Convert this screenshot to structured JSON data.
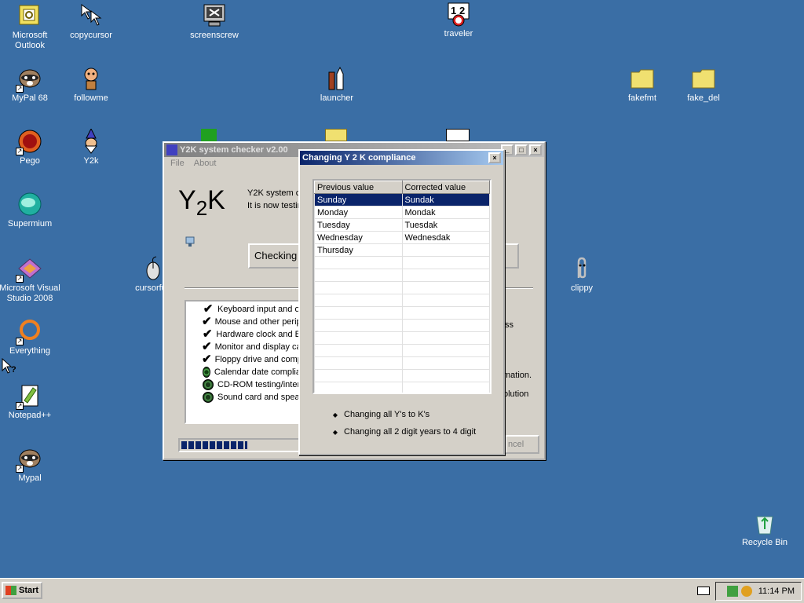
{
  "desktop": {
    "icons": [
      {
        "label": "Microsoft\nOutlook",
        "icon": "outlook-icon"
      },
      {
        "label": "copycursor",
        "icon": "cursors-icon"
      },
      {
        "label": "screenscrew",
        "icon": "monitor-icon"
      },
      {
        "label": "traveler",
        "icon": "calendar-clock-icon"
      },
      {
        "label": "MyPal 68",
        "icon": "raccoon-icon"
      },
      {
        "label": "followme",
        "icon": "character-icon"
      },
      {
        "label": "launcher",
        "icon": "rocket-icon"
      },
      {
        "label": "fakefmt",
        "icon": "folder-icon"
      },
      {
        "label": "fake_del",
        "icon": "folder-icon"
      },
      {
        "label": "Pego",
        "icon": "red-ball-icon"
      },
      {
        "label": "Y2k",
        "icon": "wizard-icon"
      },
      {
        "label": "Supermium",
        "icon": "cloud-icon"
      },
      {
        "label": "Microsoft Visual Studio 2008",
        "icon": "visual-studio-icon"
      },
      {
        "label": "cursorfun",
        "icon": "mouse-icon"
      },
      {
        "label": "clippy",
        "icon": "paperclip-icon"
      },
      {
        "label": "Everything",
        "icon": "search-ring-icon"
      },
      {
        "label": "Notepad++",
        "icon": "notepad-icon"
      },
      {
        "label": "Mypal",
        "icon": "raccoon-icon"
      },
      {
        "label": "Recycle Bin",
        "icon": "recycle-bin-icon"
      }
    ],
    "background_color": "#3a6ea5"
  },
  "main_window": {
    "title": "Y2K system checker v2.00",
    "menu": [
      "File",
      "About"
    ],
    "logo_text": "Y2K",
    "intro_line1": "Y2K system c",
    "intro_line2": "It is now testin",
    "checking_button": "Checking",
    "checklist": [
      {
        "label": "Keyboard input and o",
        "state": "checked"
      },
      {
        "label": "Mouse and other perip",
        "state": "checked"
      },
      {
        "label": "Hardware clock and B",
        "state": "checked"
      },
      {
        "label": "Monitor and display ca",
        "state": "checked"
      },
      {
        "label": "Floppy drive and comp",
        "state": "checked"
      },
      {
        "label": "Calendar date complia",
        "state": "in-progress"
      },
      {
        "label": "CD-ROM testing/inter",
        "state": "pending"
      },
      {
        "label": "Sound card and spea",
        "state": "pending"
      }
    ],
    "right_text": [
      "ss",
      "mation.",
      "olution"
    ],
    "cancel_button": "ncel",
    "progress_fraction": 0.55
  },
  "dialog": {
    "title": "Changing Y 2 K compliance",
    "columns": [
      "Previous value",
      "Corrected value"
    ],
    "rows": [
      [
        "Sunday",
        "Sundak"
      ],
      [
        "Monday",
        "Mondak"
      ],
      [
        "Tuesday",
        "Tuesdak"
      ],
      [
        "Wednesday",
        "Wednesdak"
      ],
      [
        "Thursday",
        ""
      ]
    ],
    "selected_row": 0,
    "bullets": [
      "Changing all Y's to K's",
      "Changing all 2 digit years to 4 digit"
    ]
  },
  "taskbar": {
    "start_label": "Start",
    "clock": "11:14 PM"
  }
}
